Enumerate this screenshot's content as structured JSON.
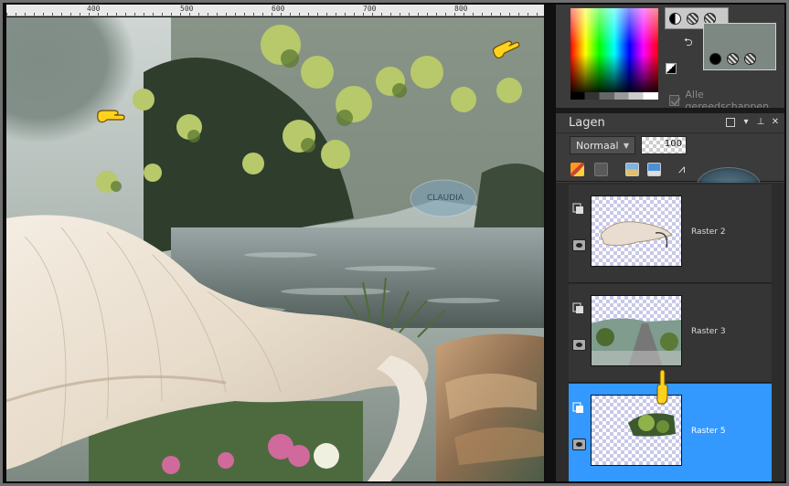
{
  "ruler": {
    "labels": [
      "400",
      "500",
      "600",
      "700",
      "800"
    ]
  },
  "colors": {
    "foreground": "#7e8883",
    "all_tools_label": "Alle gereedschappen"
  },
  "layers": {
    "title": "Lagen",
    "blend_mode": "Normaal",
    "opacity": "100",
    "items": [
      {
        "name": "Raster 2",
        "selected": false
      },
      {
        "name": "Raster 3",
        "selected": false
      },
      {
        "name": "Raster 5",
        "selected": true
      }
    ]
  },
  "icons": {
    "pointer": "pointing-hand-icon",
    "watermark": "claudia-watermark"
  },
  "theme": {
    "panel_bg": "#3b3b3b",
    "selected": "#3399ff"
  }
}
